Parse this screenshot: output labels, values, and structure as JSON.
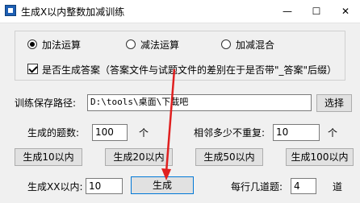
{
  "window": {
    "title": "生成X以内整数加减训练",
    "min_glyph": "—",
    "max_glyph": "☐",
    "close_glyph": "✕"
  },
  "mode": {
    "options": [
      "加法运算",
      "减法运算",
      "加减混合"
    ],
    "selected": "加法运算"
  },
  "answer_option": {
    "label": "是否生成答案（答案文件与试题文件的差别在于是否带\"_答案\"后缀）",
    "checked": true
  },
  "save_path": {
    "label": "训练保存路径:",
    "value": "D:\\tools\\桌面\\下载吧",
    "browse_label": "选择"
  },
  "question_count": {
    "label": "生成的题数:",
    "value": "100",
    "unit": "个"
  },
  "no_repeat": {
    "label": "相邻多少不重复:",
    "value": "10",
    "unit": "个"
  },
  "presets": [
    "生成10以内",
    "生成20以内",
    "生成50以内",
    "生成100以内"
  ],
  "custom_range": {
    "label": "生成XX以内:",
    "value": "10"
  },
  "generate_label": "生成",
  "per_line": {
    "label": "每行几道题:",
    "value": "4",
    "unit": "道"
  },
  "colors": {
    "accent_border": "#0078d7",
    "arrow": "#e02020"
  }
}
